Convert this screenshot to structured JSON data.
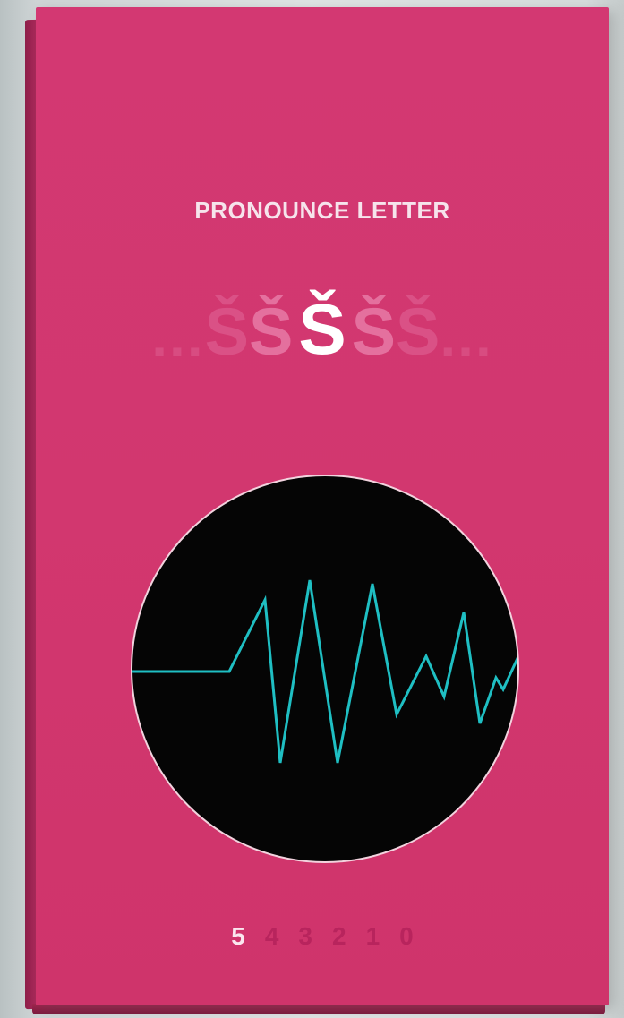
{
  "screen": {
    "title": "PRONOUNCE LETTER",
    "letter_strip": {
      "left_dots": "...",
      "letters": [
        "Š",
        "Š",
        "Š",
        "Š",
        "Š"
      ],
      "current_index": 2,
      "right_dots": "..."
    },
    "waveform": {
      "trace_color": "#1fbfc3",
      "background_color": "#050505",
      "ring_color": "#f2d3de"
    },
    "countdown": {
      "numbers": [
        "5",
        "4",
        "3",
        "2",
        "1",
        "0"
      ],
      "current": "5"
    }
  },
  "colors": {
    "card": "#d33872",
    "accent_text": "#ffffff"
  }
}
